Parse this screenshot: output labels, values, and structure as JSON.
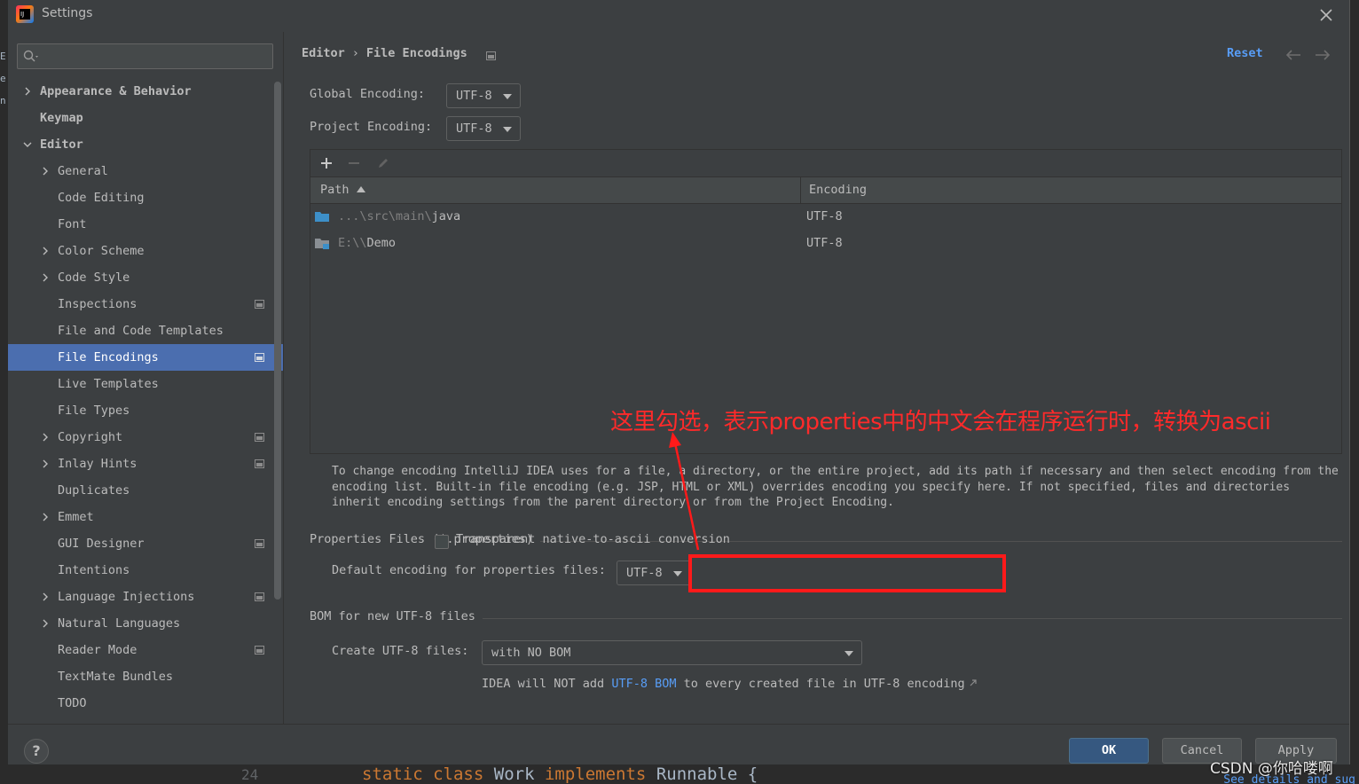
{
  "window": {
    "title": "Settings"
  },
  "sidebar": {
    "search_placeholder": "",
    "items": [
      {
        "label": "Appearance & Behavior",
        "level": 0,
        "expandable": true,
        "expanded": false,
        "bold": true,
        "project_icon": false
      },
      {
        "label": "Keymap",
        "level": 0,
        "expandable": false,
        "bold": true,
        "project_icon": false
      },
      {
        "label": "Editor",
        "level": 0,
        "expandable": true,
        "expanded": true,
        "bold": true,
        "project_icon": false
      },
      {
        "label": "General",
        "level": 1,
        "expandable": true,
        "expanded": false,
        "project_icon": false
      },
      {
        "label": "Code Editing",
        "level": 1,
        "expandable": false,
        "project_icon": false
      },
      {
        "label": "Font",
        "level": 1,
        "expandable": false,
        "project_icon": false
      },
      {
        "label": "Color Scheme",
        "level": 1,
        "expandable": true,
        "expanded": false,
        "project_icon": false
      },
      {
        "label": "Code Style",
        "level": 1,
        "expandable": true,
        "expanded": false,
        "project_icon": false
      },
      {
        "label": "Inspections",
        "level": 1,
        "expandable": false,
        "project_icon": true
      },
      {
        "label": "File and Code Templates",
        "level": 1,
        "expandable": false,
        "project_icon": false
      },
      {
        "label": "File Encodings",
        "level": 1,
        "expandable": false,
        "project_icon": true,
        "selected": true
      },
      {
        "label": "Live Templates",
        "level": 1,
        "expandable": false,
        "project_icon": false
      },
      {
        "label": "File Types",
        "level": 1,
        "expandable": false,
        "project_icon": false
      },
      {
        "label": "Copyright",
        "level": 1,
        "expandable": true,
        "expanded": false,
        "project_icon": true
      },
      {
        "label": "Inlay Hints",
        "level": 1,
        "expandable": true,
        "expanded": false,
        "project_icon": true
      },
      {
        "label": "Duplicates",
        "level": 1,
        "expandable": false,
        "project_icon": false
      },
      {
        "label": "Emmet",
        "level": 1,
        "expandable": true,
        "expanded": false,
        "project_icon": false
      },
      {
        "label": "GUI Designer",
        "level": 1,
        "expandable": false,
        "project_icon": true
      },
      {
        "label": "Intentions",
        "level": 1,
        "expandable": false,
        "project_icon": false
      },
      {
        "label": "Language Injections",
        "level": 1,
        "expandable": true,
        "expanded": false,
        "project_icon": true
      },
      {
        "label": "Natural Languages",
        "level": 1,
        "expandable": true,
        "expanded": false,
        "project_icon": false
      },
      {
        "label": "Reader Mode",
        "level": 1,
        "expandable": false,
        "project_icon": true
      },
      {
        "label": "TextMate Bundles",
        "level": 1,
        "expandable": false,
        "project_icon": false
      },
      {
        "label": "TODO",
        "level": 1,
        "expandable": false,
        "project_icon": false
      }
    ]
  },
  "breadcrumb": {
    "parent": "Editor",
    "separator": "›",
    "current": "File Encodings"
  },
  "header": {
    "reset_label": "Reset"
  },
  "global_encoding": {
    "label": "Global Encoding:",
    "value": "UTF-8"
  },
  "project_encoding": {
    "label": "Project Encoding:",
    "value": "UTF-8"
  },
  "table": {
    "toolbar": [
      "add-icon",
      "remove-icon",
      "edit-icon"
    ],
    "columns": {
      "path": "Path",
      "encoding": "Encoding"
    },
    "rows": [
      {
        "path_prefix": "...\\src\\main\\",
        "path_main": "java",
        "encoding": "UTF-8",
        "icon": "folder-icon"
      },
      {
        "path_prefix": "E:\\\\",
        "path_main": "Demo",
        "encoding": "UTF-8",
        "icon": "module-folder-icon"
      }
    ]
  },
  "help_text": "To change encoding IntelliJ IDEA uses for a file, a directory, or the entire project, add its path if necessary and then select encoding from the encoding list. Built-in file encoding (e.g. JSP, HTML or XML) overrides encoding you specify here. If not specified, files and directories inherit encoding settings from the parent directory or from the Project Encoding.",
  "properties_section": {
    "title": "Properties Files (*.properties)",
    "default_label": "Default encoding for properties files:",
    "default_value": "UTF-8",
    "native_ascii_label": "Transparent native-to-ascii conversion",
    "native_ascii_checked": false
  },
  "bom_section": {
    "title": "BOM for new UTF-8 files",
    "create_label": "Create UTF-8 files:",
    "create_value": "with NO BOM",
    "note_before": "IDEA will NOT add ",
    "note_link": "UTF-8 BOM",
    "note_after": " to every created file in UTF-8 encoding"
  },
  "annotation": {
    "text": "这里勾选，表示properties中的中文会在程序运行时，转换为ascii",
    "color": "#ff2a2a"
  },
  "footer": {
    "help_label": "?",
    "ok_label": "OK",
    "cancel_label": "Cancel",
    "apply_label": "Apply"
  },
  "background": {
    "code_keyword1": "static",
    "code_keyword2": "class",
    "code_word": "Work",
    "code_keyword3": "implements",
    "code_word2": "Runnable {",
    "line_number": "24",
    "see_details": "See details and sug"
  },
  "watermark": "CSDN @你哈喽啊",
  "colors": {
    "accent": "#589df6",
    "selection": "#4b6eaf",
    "panel": "#3c3f41",
    "primary_button": "#365880"
  }
}
